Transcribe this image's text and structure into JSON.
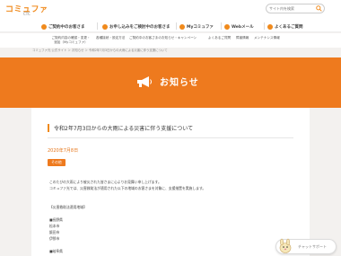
{
  "header": {
    "logo_main": "コミュファ",
    "logo_sub": "CTC",
    "search_placeholder": "サイト内を検索"
  },
  "nav": {
    "items": [
      {
        "label": "ご契約中のお客さま"
      },
      {
        "label": "お申し込みをご検討中のお客さま"
      },
      {
        "label": "Myコミュファ"
      },
      {
        "label": "Webメール"
      },
      {
        "label": "よくあるご質問"
      }
    ]
  },
  "subnav": {
    "items": [
      {
        "label": "ご契約内容の確認・変更・追加（Myコミュファ）"
      },
      {
        "label": "各種接続・設定方法"
      },
      {
        "label": "ご契約中のお客さまのお知らせ・キャンペーン"
      },
      {
        "label": "よくあるご質問"
      },
      {
        "label": "障害情報"
      },
      {
        "label": "メンテナンス情報"
      }
    ]
  },
  "breadcrumb": "コミュファ光 公式サイト ＞ お知らせ ＞ 令和2年7月3日からの大雨による災害に伴う支援について",
  "hero": {
    "title": "お知らせ",
    "accent": "#ee7a1e"
  },
  "article": {
    "title": "令和2年7月3日からの大雨による災害に伴う支援について",
    "date": "2020年7月8日",
    "badge": "その他",
    "para1": "このたびの大雨により被災された皆さまに心よりお見舞い申し上げます。",
    "para2": "コミュファ光では、災害救助法が適用された以下の地域のお客さまを対象に、支援措置を実施します。",
    "section_label": "【災害救助法適用地域】",
    "pref1": "■長野県",
    "city1": "松本市",
    "city2": "飯田市",
    "city3": "伊那市",
    "pref2": "■岐阜県"
  },
  "chat": {
    "label": "チャットサポート"
  }
}
